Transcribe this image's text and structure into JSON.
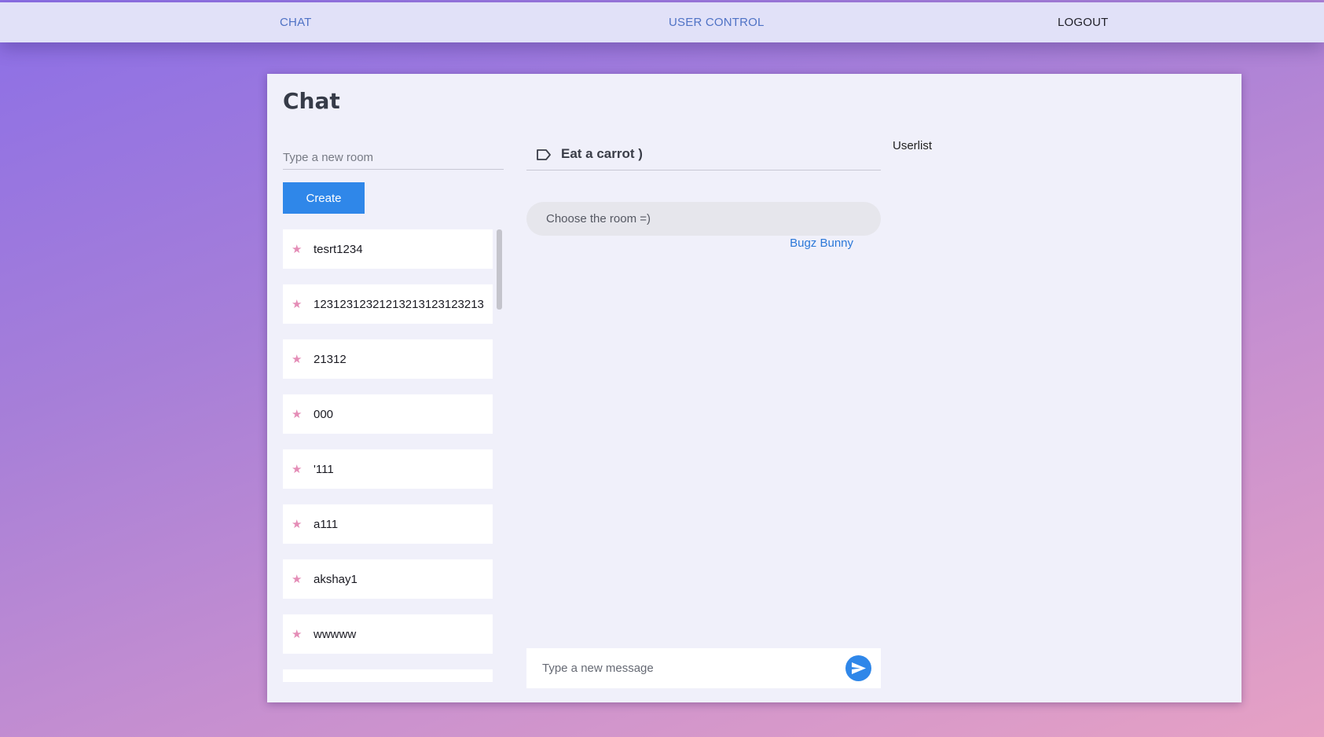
{
  "nav": {
    "chat": "CHAT",
    "user_control": "USER CONTROL",
    "logout": "LOGOUT"
  },
  "page": {
    "title": "Chat"
  },
  "rooms_panel": {
    "input_placeholder": "Type a new room",
    "create_label": "Create",
    "rooms": [
      {
        "label": "tesrt1234",
        "icon": "star-icon"
      },
      {
        "label": "12312312321213213123123213",
        "icon": "star-icon"
      },
      {
        "label": "21312",
        "icon": "star-icon"
      },
      {
        "label": "000",
        "icon": "star-icon"
      },
      {
        "label": "'111",
        "icon": "star-icon"
      },
      {
        "label": "a111",
        "icon": "star-icon"
      },
      {
        "label": "akshay1",
        "icon": "star-icon"
      },
      {
        "label": "wwwww",
        "icon": "star-icon"
      },
      {
        "label": "",
        "icon": "star-icon"
      }
    ]
  },
  "chat": {
    "room_name": "Eat a carrot )",
    "messages": [
      {
        "text": "Choose the room =)",
        "author": "Bugz Bunny"
      }
    ],
    "input_placeholder": "Type a new message"
  },
  "userlist": {
    "label": "Userlist"
  },
  "colors": {
    "accent": "#2f87e9",
    "navbar_bg": "#e1e1f8",
    "nav_link": "#4f72c5",
    "star": "#e48cb6",
    "card_bg": "#f0f0fa"
  }
}
